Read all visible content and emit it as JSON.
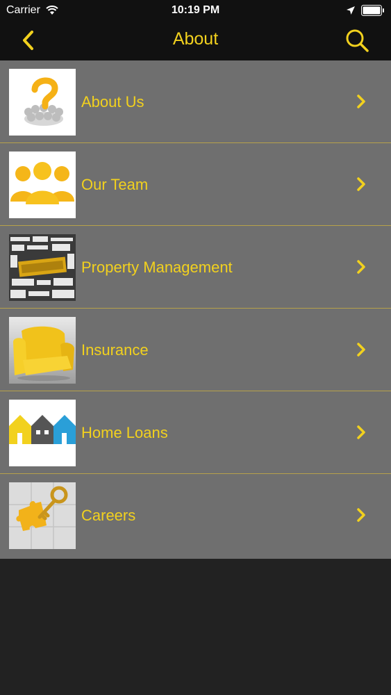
{
  "status_bar": {
    "carrier": "Carrier",
    "time": "10:19 PM"
  },
  "nav": {
    "title": "About",
    "back_icon": "chevron-left-icon",
    "search_icon": "search-icon"
  },
  "colors": {
    "accent": "#F2D11E",
    "bar_bg": "#111111",
    "list_bg": "#6f6f6f",
    "page_bg": "#222222"
  },
  "menu": {
    "items": [
      {
        "label": "About Us",
        "thumb": "question-figure-thumbnail"
      },
      {
        "label": "Our Team",
        "thumb": "team-silhouettes-thumbnail"
      },
      {
        "label": "Property Management",
        "thumb": "invest-words-thumbnail"
      },
      {
        "label": "Insurance",
        "thumb": "yellow-armchair-thumbnail"
      },
      {
        "label": "Home Loans",
        "thumb": "houses-thumbnail"
      },
      {
        "label": "Careers",
        "thumb": "key-puzzle-thumbnail"
      }
    ]
  }
}
